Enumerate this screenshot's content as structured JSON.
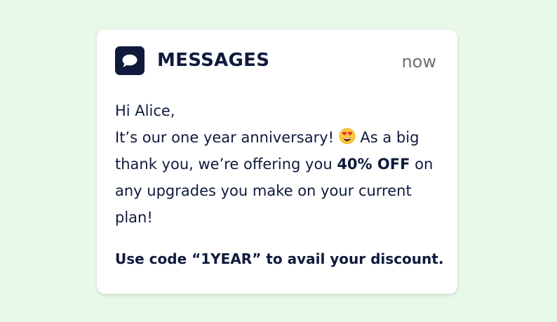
{
  "notification": {
    "app_name": "MESSAGES",
    "app_icon": "message-bubble-icon",
    "timestamp": "now",
    "greeting": "Hi Alice,",
    "line1_pre": "It’s our one year anniversary! ",
    "emoji": "heart-eyes-emoji",
    "line1_post": " As a big",
    "line2_pre": "thank you, we’re offering you ",
    "discount": "40% OFF",
    "line2_post": " on",
    "line3": "any upgrades you make on your current",
    "line4": "plan!",
    "cta": "Use code “1YEAR” to avail your discount."
  },
  "colors": {
    "page_background": "#e8f8e9",
    "card_background": "#ffffff",
    "text_primary": "#0f1a3d",
    "text_muted": "#6d6f74",
    "icon_background": "#0f1a3d"
  }
}
